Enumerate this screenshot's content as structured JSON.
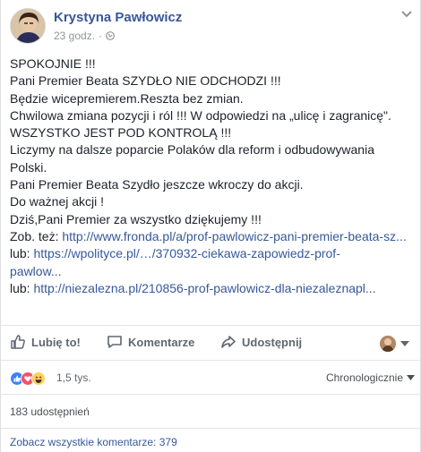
{
  "post": {
    "author": "Krystyna Pawłowicz",
    "time": "23 godz.",
    "separator": "·",
    "lines": [
      {
        "text": "SPOKOJNIE !!!",
        "link": false
      },
      {
        "text": "Pani Premier Beata SZYDŁO NIE ODCHODZI !!!",
        "link": false
      },
      {
        "text": "Będzie wicepremierem.Reszta bez zmian.",
        "link": false
      },
      {
        "text": "Chwilowa zmiana pozycji i ról !!! W odpowiedzi na „ulicę i zagranicę\".",
        "link": false
      },
      {
        "text": "WSZYSTKO JEST POD KONTROLĄ !!!",
        "link": false
      },
      {
        "text": "Liczymy na dalsze poparcie Polaków dla reform i odbudowywania",
        "link": false
      },
      {
        "text": "Polski.",
        "link": false
      },
      {
        "text": "Pani Premier Beata Szydło jeszcze wkroczy do akcji.",
        "link": false
      },
      {
        "text": "Do ważnej akcji !",
        "link": false
      },
      {
        "text": "Dziś,Pani Premier za wszystko dziękujemy !!!",
        "link": false
      }
    ],
    "links": [
      {
        "prefix": "Zob. też: ",
        "url": "http://www.fronda.pl/a/prof-pawlowicz-pani-premier-beata-sz..."
      },
      {
        "prefix": "lub: ",
        "url": "https://wpolityce.pl/…/370932-ciekawa-zapowiedz-prof-"
      },
      {
        "prefix": "",
        "url": "pawlow..."
      },
      {
        "prefix": "lub: ",
        "url": "http://niezalezna.pl/210856-prof-pawlowicz-dla-niezaleznapl..."
      }
    ]
  },
  "actions": {
    "like": "Lubię to!",
    "comment": "Komentarze",
    "share": "Udostępnij"
  },
  "reactions": {
    "count": "1,5 tys.",
    "sort": "Chronologicznie",
    "colors": {
      "like": "#4080ff",
      "love": "#f25268",
      "haha": "#fcd05b"
    }
  },
  "shares": "183 udostępnień",
  "all_comments": "Zobacz wszystkie komentarze: 379",
  "icons": [
    "globe-icon",
    "chevron-down-icon",
    "like-icon",
    "comment-icon",
    "share-icon"
  ]
}
